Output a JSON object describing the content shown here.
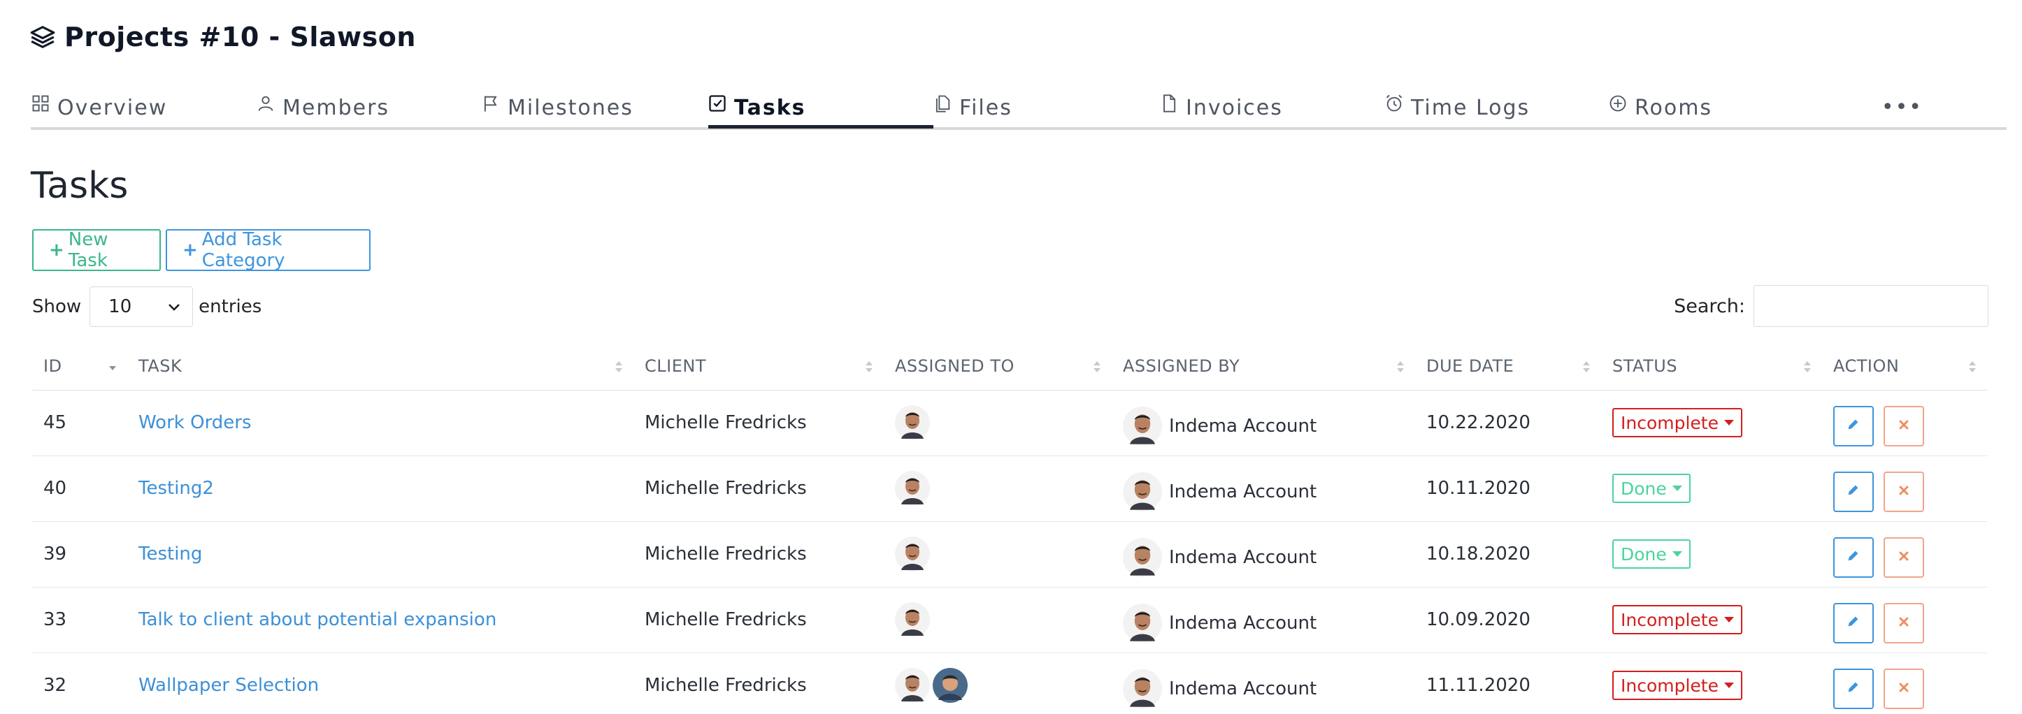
{
  "header": {
    "title": "Projects #10 - Slawson"
  },
  "tabs": [
    {
      "label": "Overview",
      "icon": "grid-icon"
    },
    {
      "label": "Members",
      "icon": "user-icon"
    },
    {
      "label": "Milestones",
      "icon": "flag-icon"
    },
    {
      "label": "Tasks",
      "icon": "checkbox-icon",
      "active": true
    },
    {
      "label": "Files",
      "icon": "files-icon"
    },
    {
      "label": "Invoices",
      "icon": "file-icon"
    },
    {
      "label": "Time Logs",
      "icon": "alarm-clock-icon"
    },
    {
      "label": "Rooms",
      "icon": "plus-circle-icon"
    }
  ],
  "more_label": "•••",
  "section": {
    "title": "Tasks"
  },
  "buttons": {
    "new_task": "New Task",
    "add_category": "Add Task Category",
    "plus": "+"
  },
  "show": {
    "prefix": "Show",
    "value": "10",
    "suffix": "entries"
  },
  "search": {
    "label": "Search:",
    "value": ""
  },
  "table": {
    "headers": [
      "ID",
      "TASK",
      "CLIENT",
      "ASSIGNED TO",
      "ASSIGNED BY",
      "DUE DATE",
      "STATUS",
      "ACTION"
    ],
    "rows": [
      {
        "id": "45",
        "task": "Work Orders",
        "client": "Michelle Fredricks",
        "assigned_by": "Indema Account",
        "due": "10.22.2020",
        "due_color": "green",
        "status": "Incomplete",
        "assignees": 1
      },
      {
        "id": "40",
        "task": "Testing2",
        "client": "Michelle Fredricks",
        "assigned_by": "Indema Account",
        "due": "10.11.2020",
        "due_color": "orange",
        "status": "Done",
        "assignees": 1
      },
      {
        "id": "39",
        "task": "Testing",
        "client": "Michelle Fredricks",
        "assigned_by": "Indema Account",
        "due": "10.18.2020",
        "due_color": "green",
        "status": "Done",
        "assignees": 1
      },
      {
        "id": "33",
        "task": "Talk to client about potential expansion",
        "client": "Michelle Fredricks",
        "assigned_by": "Indema Account",
        "due": "10.09.2020",
        "due_color": "orange",
        "status": "Incomplete",
        "assignees": 1
      },
      {
        "id": "32",
        "task": "Wallpaper Selection",
        "client": "Michelle Fredricks",
        "assigned_by": "Indema Account",
        "due": "11.11.2020",
        "due_color": "green",
        "status": "Incomplete",
        "assignees": 2
      }
    ]
  },
  "colors": {
    "accent_green": "#3ab88a",
    "accent_blue": "#3d95de",
    "incomplete": "#d31e1e",
    "done": "#4bd49c",
    "due_orange": "#f08a5d"
  }
}
